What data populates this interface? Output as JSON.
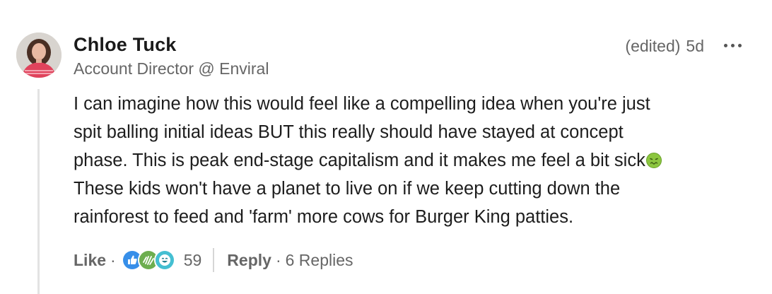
{
  "comment": {
    "author": {
      "name": "Chloe Tuck",
      "headline": "Account Director @ Enviral"
    },
    "edited_label": "(edited)",
    "timestamp": "5d",
    "body_lines": [
      " I can imagine how this would feel like a compelling idea when you're just",
      "spit balling initial ideas BUT this really should have stayed at concept",
      "phase. This is peak end-stage capitalism and it makes me feel a bit sick",
      "These kids won't have a planet to live on if we keep cutting down the",
      "rainforest to feed and 'farm' more cows for Burger King patties."
    ],
    "actions": {
      "like_label": "Like",
      "dot": "·",
      "reaction_count": "59",
      "reply_label": "Reply",
      "replies_label": "6 Replies"
    }
  },
  "icons": {
    "sick_emoji": "nauseated-face-icon",
    "reactions": [
      "like-icon",
      "support-icon",
      "funny-icon"
    ],
    "more": "more-options-icon"
  },
  "colors": {
    "name": "#1a1a1a",
    "secondary_text": "#666666",
    "body_text": "#1d1d1d",
    "like_reaction": "#378fe9",
    "support_reaction": "#6dae4f",
    "funny_reaction": "#44bfd2",
    "thread_line": "#e3e3e3"
  }
}
